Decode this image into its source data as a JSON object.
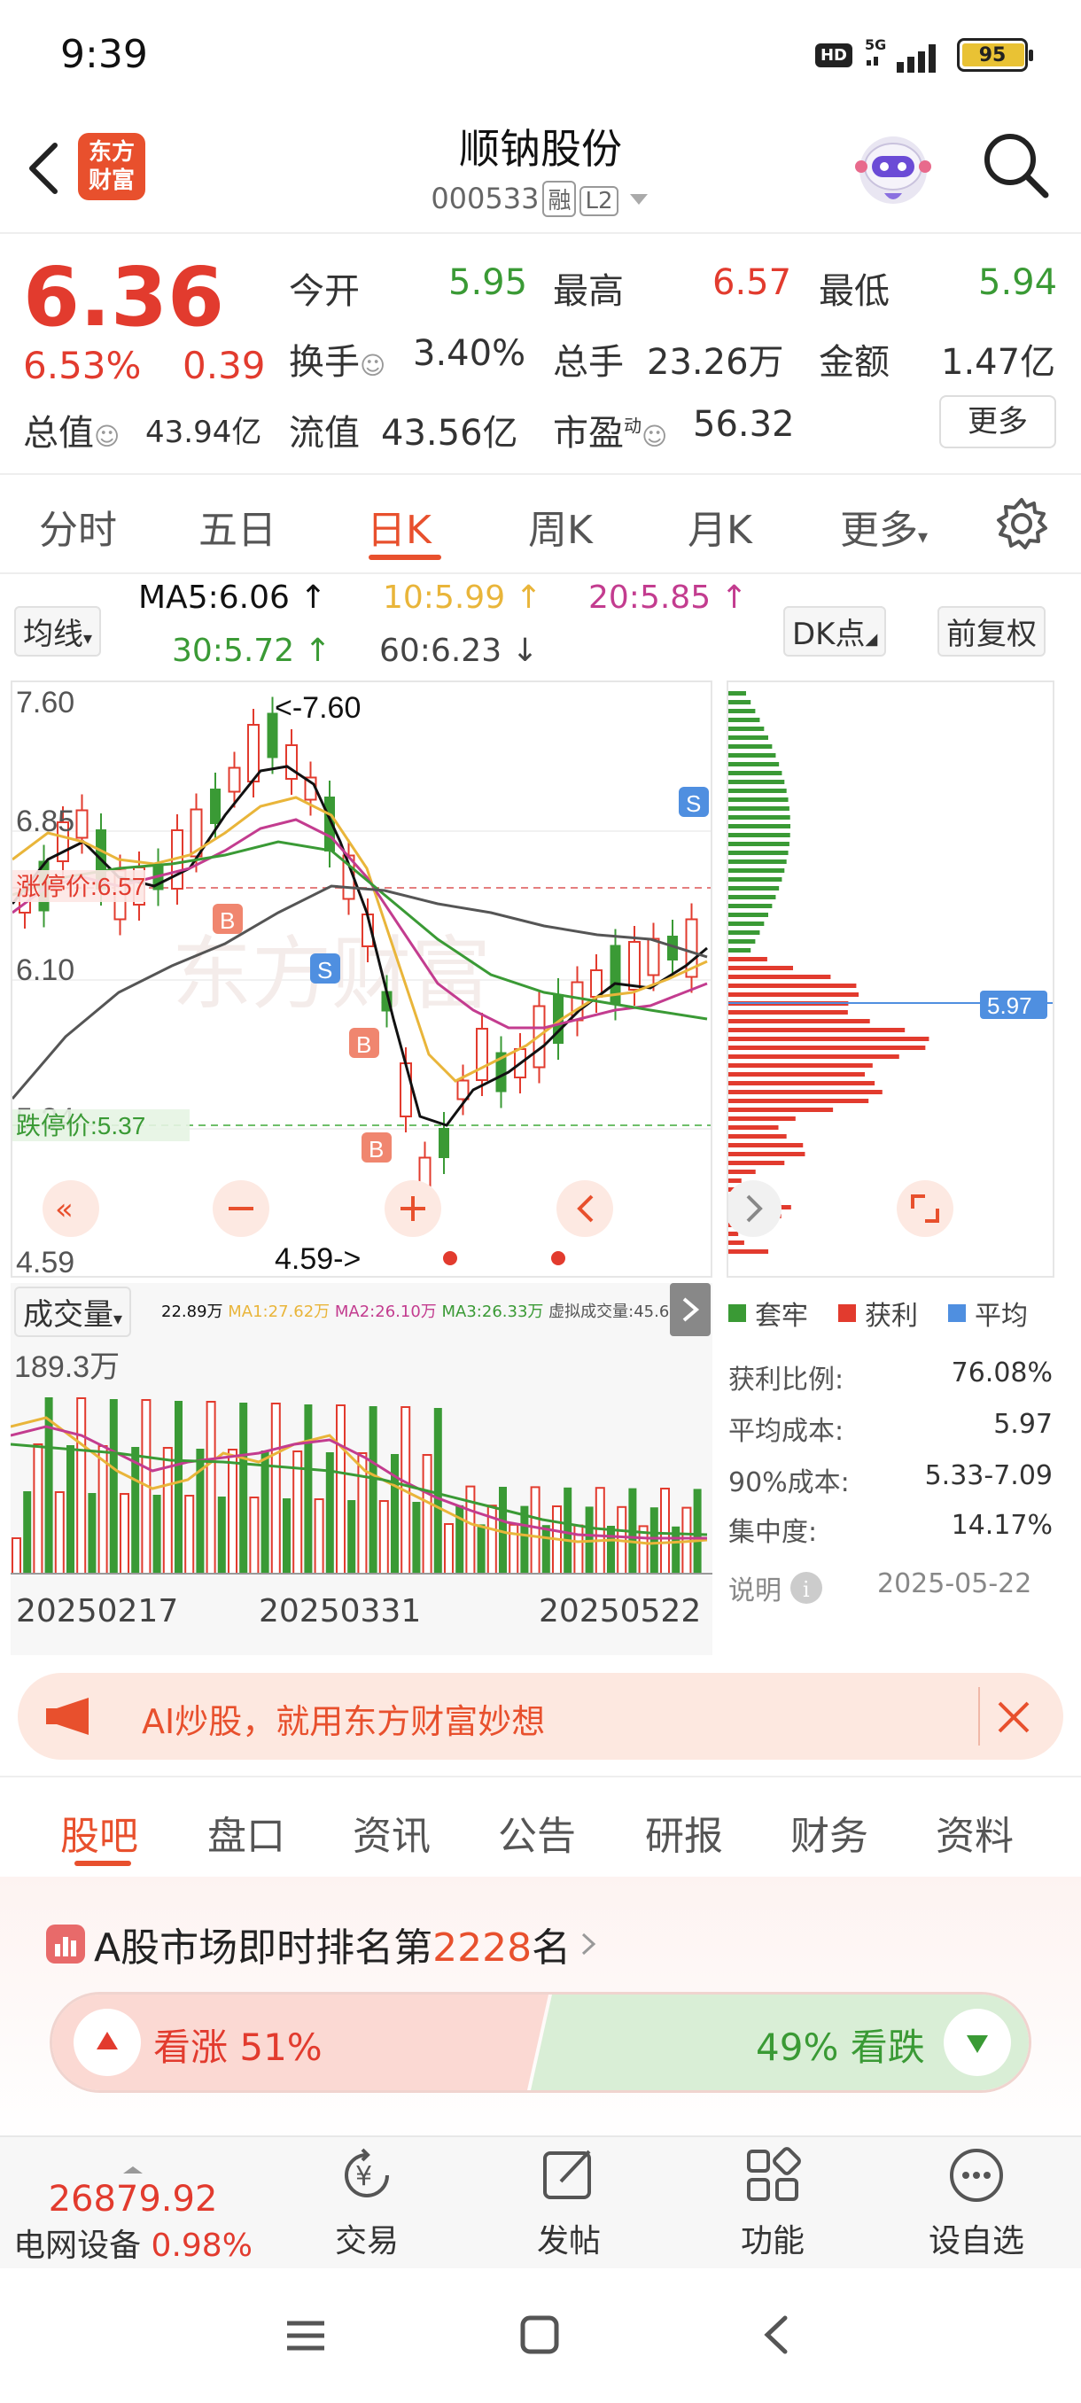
{
  "status": {
    "time": "9:39",
    "network": "5G",
    "battery": "95",
    "hd": "HD"
  },
  "header": {
    "logo_line1": "东方",
    "logo_line2": "财富",
    "title": "顺钠股份",
    "code": "000533",
    "tag1": "融",
    "tag2": "L2"
  },
  "quote": {
    "price": "6.36",
    "change_pct": "6.53%",
    "change_amt": "0.39",
    "open_label": "今开",
    "open": "5.95",
    "high_label": "最高",
    "high": "6.57",
    "low_label": "最低",
    "low": "5.94",
    "turnover_label": "换手",
    "turnover": "3.40%",
    "volume_label": "总手",
    "volume": "23.26万",
    "amount_label": "金额",
    "amount": "1.47亿",
    "mcap_label": "总值",
    "mcap": "43.94亿",
    "float_label": "流值",
    "float_cap": "43.56亿",
    "pe_label": "市盈",
    "pe_sup": "动",
    "pe": "56.32",
    "more": "更多"
  },
  "ktabs": [
    "分时",
    "五日",
    "日K",
    "周K",
    "月K",
    "更多"
  ],
  "ktab_active": 2,
  "ma_legend": {
    "select": "均线",
    "ma5": "MA5:6.06 ↑",
    "ma10": "10:5.99 ↑",
    "ma20": "20:5.85 ↑",
    "ma30": "30:5.72 ↑",
    "ma60": "60:6.23 ↓",
    "dk": "DK点",
    "fq": "前复权"
  },
  "price_axis": {
    "top": "7.60",
    "t2": "6.85",
    "t3": "6.10",
    "t4": "5.34",
    "bottom": "4.59"
  },
  "annotations": {
    "high_mark": "<-7.60",
    "low_mark": "4.59->",
    "limit_up": "涨停价:6.57",
    "limit_down": "跌停价:5.37",
    "cost": "5.97",
    "buy": "B",
    "sell": "S"
  },
  "volume_panel": {
    "select": "成交量",
    "legend": [
      "22.89万",
      "MA1:27.62万",
      "MA2:26.10万",
      "MA3:26.33万",
      "虚拟成交量:45.64万"
    ],
    "max": "189.3万",
    "dates": [
      "20250217",
      "20250331",
      "20250522"
    ]
  },
  "chip": {
    "legend": [
      "套牢",
      "获利",
      "平均"
    ],
    "rows": [
      {
        "label": "获利比例:",
        "value": "76.08%"
      },
      {
        "label": "平均成本:",
        "value": "5.97"
      },
      {
        "label": "90%成本:",
        "value": "5.33-7.09"
      },
      {
        "label": "集中度:",
        "value": "14.17%"
      }
    ],
    "note": "说明",
    "date": "2025-05-22"
  },
  "banner": {
    "text": "AI炒股，就用东方财富妙想"
  },
  "bottom_tabs": [
    "股吧",
    "盘口",
    "资讯",
    "公告",
    "研报",
    "财务",
    "资料"
  ],
  "rank": {
    "prefix": "A股市场即时排名第",
    "number": "2228",
    "suffix": "名"
  },
  "sentiment": {
    "up": "看涨 51%",
    "down": "49% 看跌"
  },
  "index_bar": {
    "value": "26879.92",
    "name": "电网设备",
    "pct": "0.98%"
  },
  "nav": [
    "交易",
    "发帖",
    "功能",
    "设自选"
  ],
  "colors": {
    "red": "#e23b2e",
    "green": "#3a9a35",
    "accent": "#e8502d"
  }
}
